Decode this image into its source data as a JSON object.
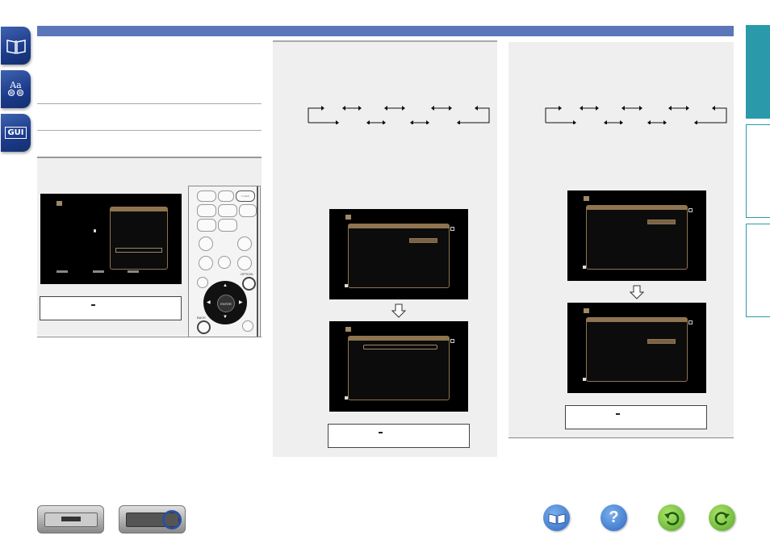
{
  "top_bar": {
    "color": "#5b77b9"
  },
  "left_nav": {
    "items": [
      {
        "icon": "book-icon"
      },
      {
        "icon": "glossary-icon",
        "text": "Aa"
      },
      {
        "icon": "gui-icon",
        "text": "GUI"
      }
    ]
  },
  "right_tabs": {
    "accent": "#2a9aaa",
    "count": 3
  },
  "remote": {
    "labels": {
      "tuner": "TUNER",
      "option": "OPTION",
      "enter": "ENTER",
      "back": "BACK"
    }
  },
  "bottom_bar": {
    "icons": [
      "front-panel-icon",
      "rear-panel-icon",
      "contents-icon",
      "help-icon",
      "back-icon",
      "forward-icon"
    ],
    "help_glyph": "?"
  }
}
